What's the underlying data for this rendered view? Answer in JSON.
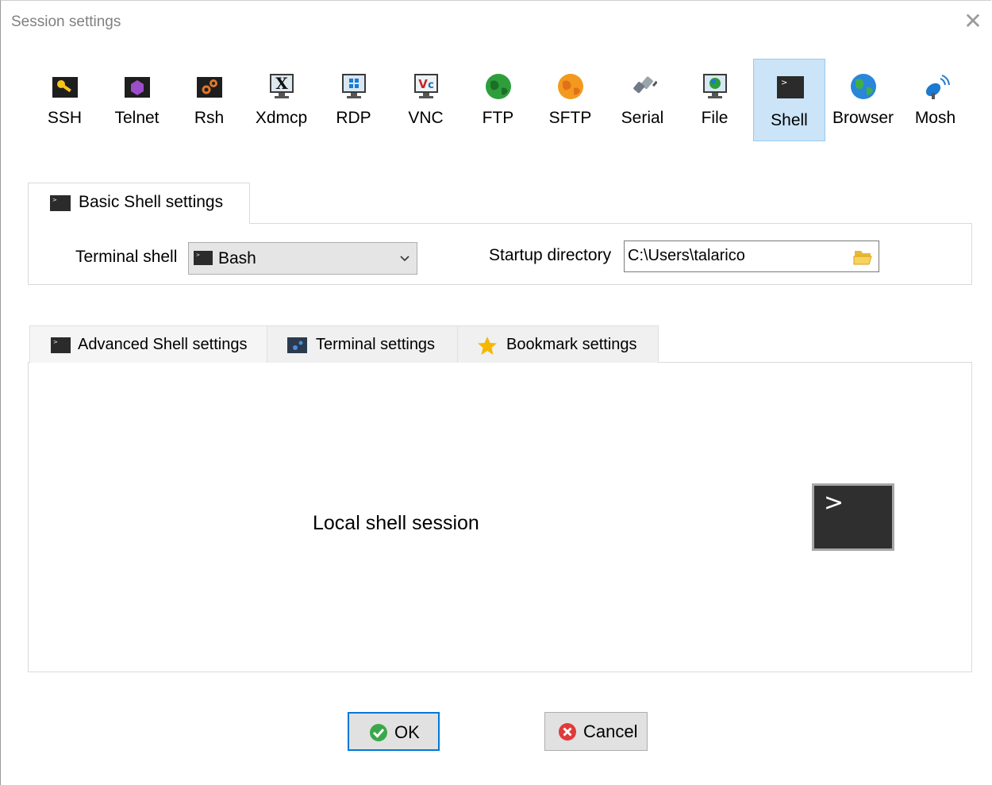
{
  "window": {
    "title": "Session settings",
    "close_glyph": "✕"
  },
  "session_types": [
    {
      "label": "SSH",
      "icon": "ssh-key-icon"
    },
    {
      "label": "Telnet",
      "icon": "telnet-icon"
    },
    {
      "label": "Rsh",
      "icon": "rsh-icon"
    },
    {
      "label": "Xdmcp",
      "icon": "xdmcp-monitor-icon"
    },
    {
      "label": "RDP",
      "icon": "rdp-monitor-icon"
    },
    {
      "label": "VNC",
      "icon": "vnc-monitor-icon"
    },
    {
      "label": "FTP",
      "icon": "ftp-globe-icon"
    },
    {
      "label": "SFTP",
      "icon": "sftp-globe-icon"
    },
    {
      "label": "Serial",
      "icon": "serial-plug-icon"
    },
    {
      "label": "File",
      "icon": "file-monitor-icon"
    },
    {
      "label": "Shell",
      "icon": "shell-terminal-icon",
      "selected": true
    },
    {
      "label": "Browser",
      "icon": "browser-globe-icon"
    },
    {
      "label": "Mosh",
      "icon": "mosh-satellite-icon"
    }
  ],
  "basic": {
    "tab_label": "Basic Shell settings",
    "terminal_shell_label": "Terminal shell",
    "terminal_shell_value": "Bash",
    "startup_dir_label": "Startup directory",
    "startup_dir_value": "C:\\Users\\talarico"
  },
  "lower_tabs": [
    {
      "label": "Advanced Shell settings",
      "icon": "terminal-icon"
    },
    {
      "label": "Terminal settings",
      "icon": "terminal-settings-icon"
    },
    {
      "label": "Bookmark settings",
      "icon": "star-icon"
    }
  ],
  "panel": {
    "description": "Local shell session",
    "prompt_glyph": ">"
  },
  "buttons": {
    "ok": "OK",
    "cancel": "Cancel"
  },
  "colors": {
    "selected_bg": "#cce4f7",
    "selected_border": "#99c9ef",
    "ok_border": "#0078d7"
  }
}
